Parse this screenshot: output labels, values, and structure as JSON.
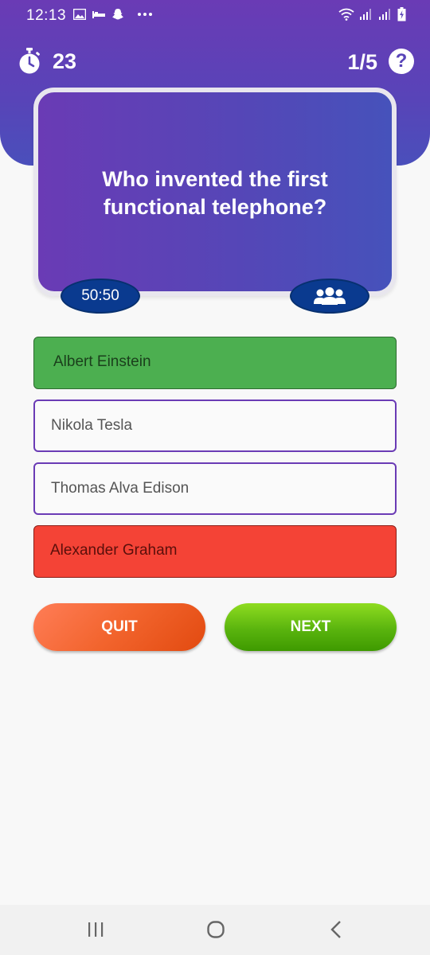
{
  "status_bar": {
    "time": "12:13",
    "icons": [
      "image-icon",
      "hotel-bed-icon",
      "snapchat-icon",
      "more-dots-icon",
      "wifi-icon",
      "signal-icon",
      "signal-icon",
      "battery-charging-icon"
    ]
  },
  "quiz": {
    "timer_value": "23",
    "progress": "1/5",
    "help_symbol": "?",
    "question": "Who invented the first functional telephone?"
  },
  "lifelines": {
    "fifty_fifty_label": "50:50",
    "audience_icon": "group-icon"
  },
  "options": [
    {
      "label": "Albert Einstein",
      "state": "correct"
    },
    {
      "label": "Nikola Tesla",
      "state": "default"
    },
    {
      "label": "Thomas Alva Edison",
      "state": "default"
    },
    {
      "label": "Alexander Graham",
      "state": "wrong"
    }
  ],
  "buttons": {
    "quit_label": "QUIT",
    "next_label": "NEXT"
  },
  "colors": {
    "header_purple": "#6a3bb5",
    "card_blue": "#4652bb",
    "correct_green": "#4caf50",
    "wrong_red": "#f44336",
    "quit_orange": "#f2642d",
    "next_green": "#5ab40e",
    "lifeline_navy": "#0a3a8f"
  },
  "nav_bar": {
    "items": [
      "recent-apps-icon",
      "home-icon",
      "back-icon"
    ]
  }
}
